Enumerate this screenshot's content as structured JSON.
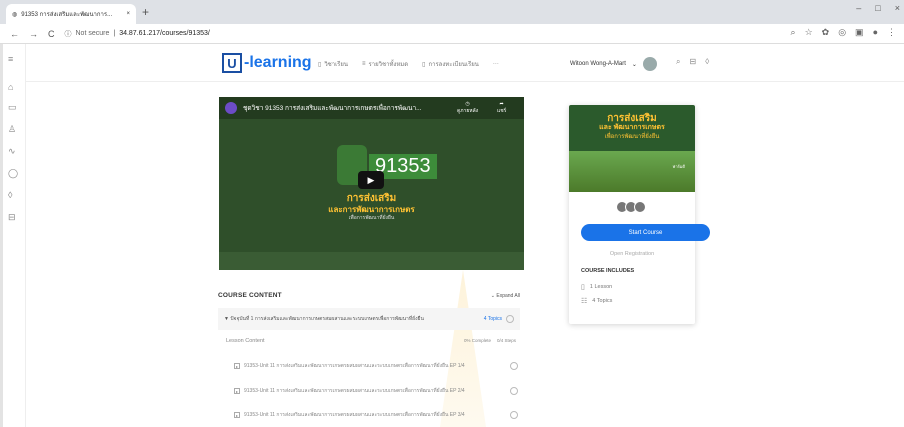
{
  "browser": {
    "tab_title": "91353 การส่งเสริมและพัฒนาการ...",
    "tab_close": "×",
    "new_tab": "+",
    "win_min": "–",
    "win_max": "□",
    "win_close": "×",
    "not_secure": "Not secure",
    "url": "34.87.61.217/courses/91353/"
  },
  "header": {
    "logo_box": "U",
    "logo_text": "-learning",
    "menu": [
      {
        "icon": "▯",
        "label": "วิชาเรียน"
      },
      {
        "icon": "≡",
        "label": "รายวิชาทั้งหมด"
      },
      {
        "icon": "▯",
        "label": "การลงทะเบียนเรียน"
      },
      {
        "icon": "",
        "label": "···"
      }
    ],
    "user_name": "Witoon Wong-A-Mart",
    "user_chevron": "⌄"
  },
  "video": {
    "title": "ชุดวิชา 91353 การส่งเสริมและพัฒนาการเกษตรเพื่อการพัฒนา...",
    "watch_later": "ดูภายหลัง",
    "share": "แชร์",
    "number": "91353",
    "line1": "การส่งเสริม",
    "line2": "และการพัฒนาการเกษตร",
    "line3": "เพื่อการพัฒนาที่ยั่งยืน",
    "play": "▶"
  },
  "course_content": {
    "title": "COURSE CONTENT",
    "expand": "⌄ Expand All",
    "section_title": "▼ ปัจจุบันที่ 1 การส่งเสริมและพัฒนาการเกษตรสมผสานและระบบเกษตรเพื่อการพัฒนาที่ยั่งยืน",
    "section_topics": "4 Topics",
    "lesson_label": "Lesson Content",
    "lesson_complete": "0% Complete",
    "lesson_steps": "0/4 Steps",
    "lessons": [
      "91353-Unit 11 การส่งเสริมและพัฒนาการเกษตรผสมผสานและระบบเกษตรเพื่อการพัฒนาที่ยั่งยืน EP 1/4",
      "91353-Unit 11 การส่งเสริมและพัฒนาการเกษตรผสมผสานและระบบเกษตรเพื่อการพัฒนาที่ยั่งยืน EP 2/4",
      "91353-Unit 11 การส่งเสริมและพัฒนาการเกษตรผสมผสานและระบบเกษตรเพื่อการพัฒนาที่ยั่งยืน EP 3/4"
    ]
  },
  "card": {
    "title1": "การส่งเสริม",
    "title2": "และ พัฒนาการเกษตร",
    "title3": "เพื่อการพัฒนาที่ยั่งยืน",
    "tag": "ฟาร์มดี",
    "start_button": "Start Course",
    "open_registration": "Open Registration",
    "includes_title": "COURSE INCLUDES",
    "include_lesson": "1 Lesson",
    "include_topics": "4 Topics"
  },
  "colors": {
    "accent": "#1a73e8",
    "brand": "#1a4fa3",
    "video_bg": "#2f4f2a",
    "highlight": "#ffc233"
  }
}
